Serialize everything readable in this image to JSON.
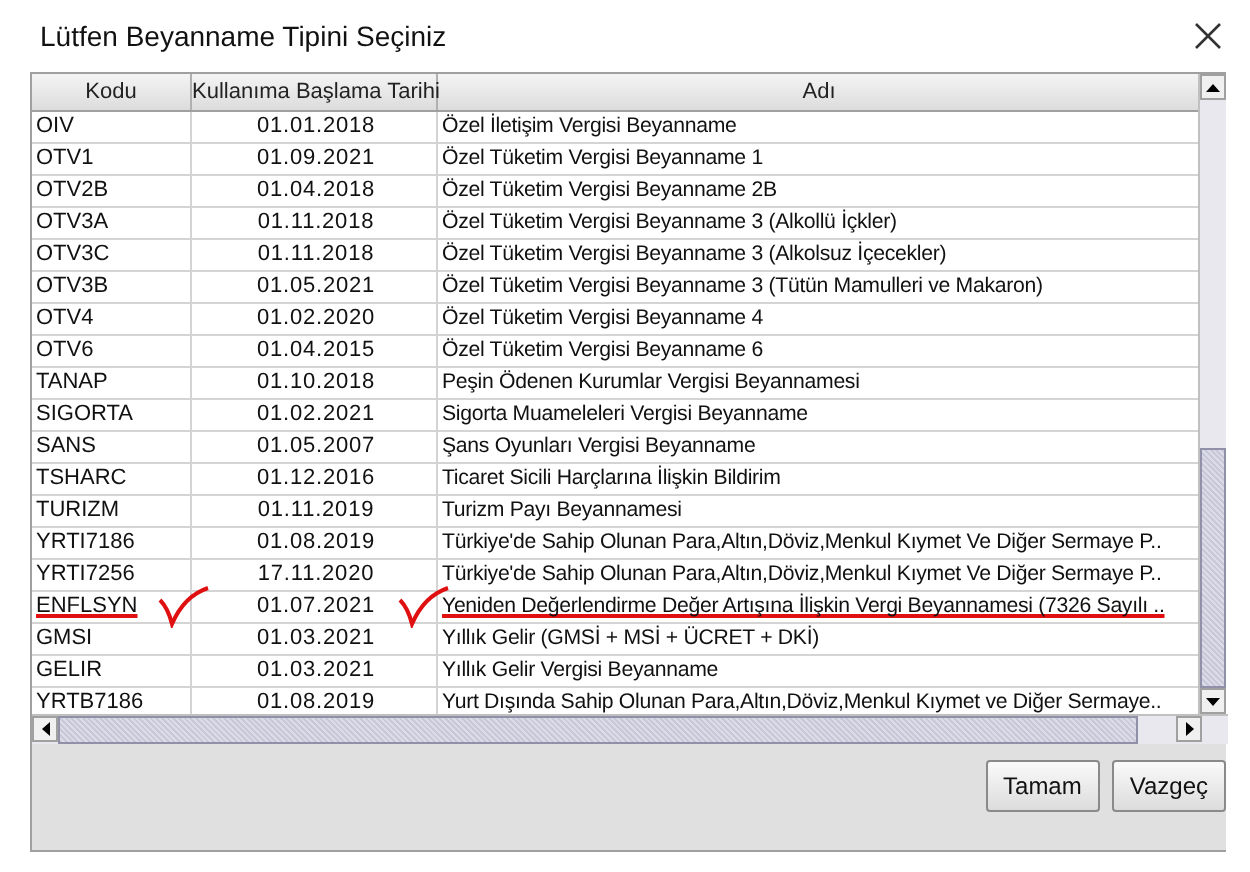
{
  "window": {
    "title": "Lütfen Beyanname Tipini Seçiniz"
  },
  "table": {
    "columns": [
      "Kodu",
      "Kullanıma Başlama Tarihi",
      "Adı"
    ],
    "rows": [
      {
        "code": "OIV",
        "date": "01.01.2018",
        "name": "Özel İletişim Vergisi Beyanname",
        "marked": false
      },
      {
        "code": "OTV1",
        "date": "01.09.2021",
        "name": "Özel Tüketim Vergisi Beyanname 1",
        "marked": false
      },
      {
        "code": "OTV2B",
        "date": "01.04.2018",
        "name": "Özel Tüketim Vergisi Beyanname 2B",
        "marked": false
      },
      {
        "code": "OTV3A",
        "date": "01.11.2018",
        "name": "Özel Tüketim Vergisi Beyanname 3 (Alkollü İçkler)",
        "marked": false
      },
      {
        "code": "OTV3C",
        "date": "01.11.2018",
        "name": "Özel Tüketim Vergisi Beyanname 3 (Alkolsuz İçecekler)",
        "marked": false
      },
      {
        "code": "OTV3B",
        "date": "01.05.2021",
        "name": "Özel Tüketim Vergisi Beyanname 3 (Tütün Mamulleri ve Makaron)",
        "marked": false
      },
      {
        "code": "OTV4",
        "date": "01.02.2020",
        "name": "Özel Tüketim Vergisi Beyanname 4",
        "marked": false
      },
      {
        "code": "OTV6",
        "date": "01.04.2015",
        "name": "Özel Tüketim Vergisi Beyanname 6",
        "marked": false
      },
      {
        "code": "TANAP",
        "date": "01.10.2018",
        "name": "Peşin Ödenen Kurumlar Vergisi Beyannamesi",
        "marked": false
      },
      {
        "code": "SIGORTA",
        "date": "01.02.2021",
        "name": "Sigorta Muameleleri Vergisi Beyanname",
        "marked": false
      },
      {
        "code": "SANS",
        "date": "01.05.2007",
        "name": "Şans Oyunları Vergisi Beyanname",
        "marked": false
      },
      {
        "code": "TSHARC",
        "date": "01.12.2016",
        "name": "Ticaret Sicili Harçlarına İlişkin Bildirim",
        "marked": false
      },
      {
        "code": "TURIZM",
        "date": "01.11.2019",
        "name": "Turizm Payı Beyannamesi",
        "marked": false
      },
      {
        "code": "YRTI7186",
        "date": "01.08.2019",
        "name": "Türkiye'de Sahip Olunan Para,Altın,Döviz,Menkul Kıymet Ve Diğer Sermaye P..",
        "marked": false
      },
      {
        "code": "YRTI7256",
        "date": "17.11.2020",
        "name": "Türkiye'de Sahip Olunan Para,Altın,Döviz,Menkul Kıymet Ve Diğer Sermaye P..",
        "marked": false
      },
      {
        "code": "ENFLSYN",
        "date": "01.07.2021",
        "name": "Yeniden Değerlendirme Değer Artışına İlişkin Vergi Beyannamesi (7326 Sayılı ..",
        "marked": true
      },
      {
        "code": "GMSI",
        "date": "01.03.2021",
        "name": "Yıllık Gelir (GMSİ + MSİ + ÜCRET + DKİ)",
        "marked": false
      },
      {
        "code": "GELIR",
        "date": "01.03.2021",
        "name": "Yıllık Gelir Vergisi Beyanname",
        "marked": false
      },
      {
        "code": "YRTB7186",
        "date": "01.08.2019",
        "name": "Yurt Dışında Sahip Olunan Para,Altın,Döviz,Menkul Kıymet ve Diğer Sermaye..",
        "marked": false
      }
    ]
  },
  "buttons": [
    "Tamam",
    "Vazgeç"
  ]
}
